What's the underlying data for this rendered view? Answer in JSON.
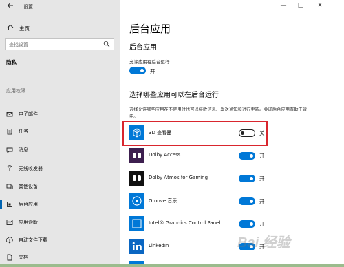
{
  "window": {
    "title": "设置",
    "back_icon": "back-arrow-icon",
    "minimize": "—",
    "maximize": "□",
    "close": "✕"
  },
  "sidebar": {
    "home_label": "主页",
    "search_placeholder": "查找设置",
    "category": "隐私",
    "section_label": "应用权限",
    "items": [
      {
        "label": "电子邮件",
        "icon": "mail-icon"
      },
      {
        "label": "任务",
        "icon": "task-icon"
      },
      {
        "label": "消息",
        "icon": "message-icon"
      },
      {
        "label": "无线收发器",
        "icon": "radio-icon"
      },
      {
        "label": "其他设备",
        "icon": "devices-icon"
      },
      {
        "label": "后台应用",
        "icon": "background-apps-icon",
        "active": true
      },
      {
        "label": "应用诊断",
        "icon": "diagnostics-icon"
      },
      {
        "label": "自动文件下载",
        "icon": "download-icon"
      },
      {
        "label": "文档",
        "icon": "document-icon"
      }
    ]
  },
  "main": {
    "page_title": "后台应用",
    "section1_title": "后台应用",
    "allow_label": "允许应用在后台运行",
    "allow_state": "开",
    "section2_title": "选择哪些应用可以在后台运行",
    "description": "选择允许哪些应用在不使用时也可以接收信息、发送通知和进行更新。关闭后台应用有助于省电。",
    "apps": [
      {
        "name": "3D 查看器",
        "state": "关",
        "on": false,
        "icon": "3d-viewer-icon"
      },
      {
        "name": "Dolby Access",
        "state": "开",
        "on": true,
        "icon": "dolby-access-icon"
      },
      {
        "name": "Dolby Atmos for Gaming",
        "state": "开",
        "on": true,
        "icon": "dolby-atmos-icon"
      },
      {
        "name": "Groove 音乐",
        "state": "开",
        "on": true,
        "icon": "groove-music-icon"
      },
      {
        "name": "Intel® Graphics Control Panel",
        "state": "开",
        "on": true,
        "icon": "intel-graphics-icon"
      },
      {
        "name": "LinkedIn",
        "state": "开",
        "on": true,
        "icon": "linkedin-icon"
      }
    ]
  },
  "colors": {
    "accent": "#0078d7",
    "highlight": "#d9262e",
    "sidebar_bg": "#e6e6e6"
  },
  "watermark": "Bai 经验"
}
